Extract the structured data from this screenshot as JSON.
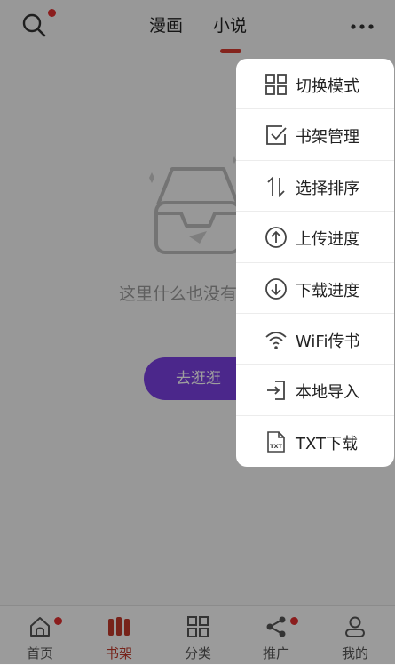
{
  "header": {
    "tabs": [
      {
        "label": "漫画",
        "active": false
      },
      {
        "label": "小说",
        "active": true
      }
    ],
    "search_has_badge": true
  },
  "empty_state": {
    "message": "这里什么也没有",
    "button_label": "去逛逛"
  },
  "menu": {
    "items": [
      {
        "label": "切换模式",
        "icon": "grid-icon"
      },
      {
        "label": "书架管理",
        "icon": "checkbox-edit-icon"
      },
      {
        "label": "选择排序",
        "icon": "sort-icon"
      },
      {
        "label": "上传进度",
        "icon": "upload-circle-icon"
      },
      {
        "label": "下载进度",
        "icon": "download-circle-icon"
      },
      {
        "label": "WiFi传书",
        "icon": "wifi-icon"
      },
      {
        "label": "本地导入",
        "icon": "import-icon"
      },
      {
        "label": "TXT下载",
        "icon": "txt-file-icon"
      }
    ]
  },
  "bottom_nav": {
    "items": [
      {
        "label": "首页",
        "icon": "home-icon",
        "badge": true,
        "active": false
      },
      {
        "label": "书架",
        "icon": "bookshelf-icon",
        "badge": false,
        "active": true
      },
      {
        "label": "分类",
        "icon": "category-icon",
        "badge": false,
        "active": false
      },
      {
        "label": "推广",
        "icon": "share-icon",
        "badge": true,
        "active": false
      },
      {
        "label": "我的",
        "icon": "profile-icon",
        "badge": false,
        "active": false
      }
    ]
  },
  "colors": {
    "accent": "#d63a2f",
    "button_purple": "#7a3fe0",
    "badge": "#e03030"
  }
}
